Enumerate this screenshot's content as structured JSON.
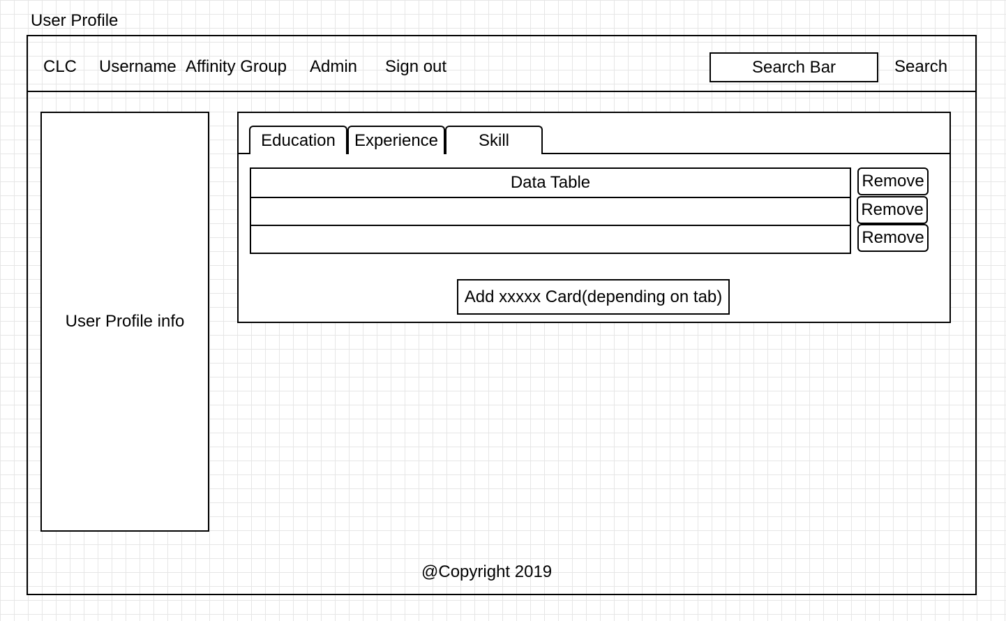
{
  "page": {
    "title": "User Profile"
  },
  "header": {
    "brand": "CLC",
    "nav": [
      {
        "label": "Username"
      },
      {
        "label": "Affinity Group"
      },
      {
        "label": "Admin"
      },
      {
        "label": "Sign out"
      }
    ],
    "search": {
      "bar_label": "Search Bar",
      "button_label": "Search"
    }
  },
  "sidebar": {
    "label": "User Profile info"
  },
  "main": {
    "tabs": [
      {
        "label": "Education"
      },
      {
        "label": "Experience"
      },
      {
        "label": "Skill"
      }
    ],
    "table": {
      "rows": [
        {
          "text": "Data Table",
          "action": "Remove"
        },
        {
          "text": "",
          "action": "Remove"
        },
        {
          "text": "",
          "action": "Remove"
        }
      ]
    },
    "add_button_label": "Add xxxxx Card(depending on tab)"
  },
  "footer": {
    "text": "@Copyright 2019"
  }
}
